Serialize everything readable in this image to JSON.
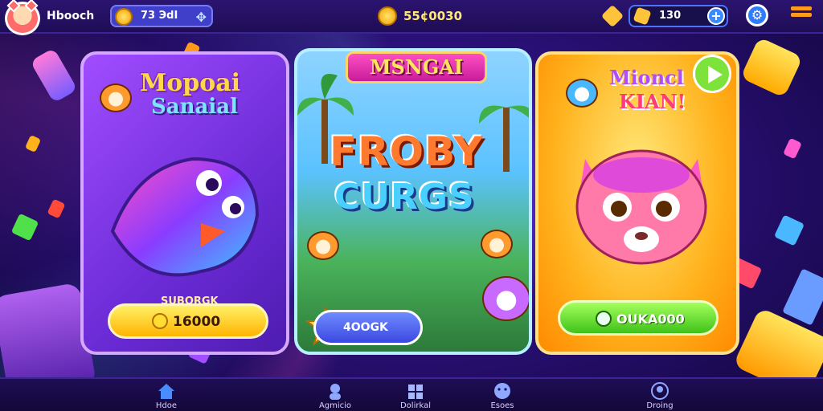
{
  "topbar": {
    "player_name": "Hbooch",
    "coin_pill_value": "73 ЭdI",
    "center_currency": "55¢0030",
    "gems_value": "130",
    "plus_label": "+"
  },
  "cards": {
    "left": {
      "title_line1": "Mopoai",
      "title_line2": "Sanaial",
      "reward_label": "SUBORGK",
      "button_price": "16000"
    },
    "mid": {
      "banner": "MSNGAI",
      "logo_line1": "FROBY",
      "logo_line2": "CURGS",
      "button_label": "4OOGK"
    },
    "right": {
      "title_line1": "Mioncl",
      "title_line2": "KIAN!",
      "button_label": "OUKA000"
    }
  },
  "bottom_nav": [
    {
      "label": "Hdoe",
      "icon": "home-icon"
    },
    {
      "label": "Agmicio",
      "icon": "character-icon"
    },
    {
      "label": "Dolirkal",
      "icon": "puzzle-icon"
    },
    {
      "label": "Esoes",
      "icon": "smiley-icon"
    },
    {
      "label": "Droing",
      "icon": "profile-icon"
    }
  ],
  "colors": {
    "accent_gold": "#ffc23b",
    "button_green": "#3fc21a",
    "button_blue": "#3b48e0",
    "background": "#2a1077"
  }
}
